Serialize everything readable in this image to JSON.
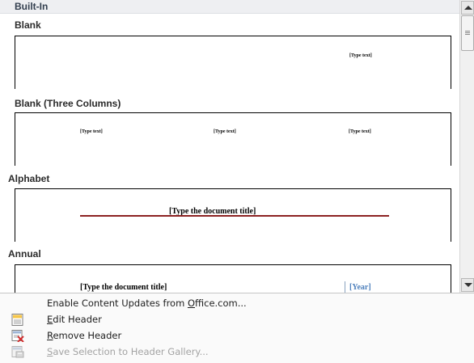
{
  "gallery": {
    "section_title": "Built-In",
    "items": [
      {
        "label": "Blank",
        "placeholders": [
          "[Type text]"
        ]
      },
      {
        "label": "Blank (Three Columns)",
        "placeholders": [
          "[Type text]",
          "[Type text]",
          "[Type text]"
        ]
      },
      {
        "label": "Alphabet",
        "title": "[Type the document title]"
      },
      {
        "label": "Annual",
        "title": "[Type the document title]",
        "year": "[Year]"
      }
    ]
  },
  "menu": {
    "items": [
      {
        "pre": "Enable Content Updates from ",
        "accel": "O",
        "post": "ffice.com...",
        "icon": "none",
        "disabled": false
      },
      {
        "pre": "",
        "accel": "E",
        "post": "dit Header",
        "icon": "edit-header-icon",
        "disabled": false
      },
      {
        "pre": "",
        "accel": "R",
        "post": "emove Header",
        "icon": "remove-header-icon",
        "disabled": false
      },
      {
        "pre": "",
        "accel": "S",
        "post": "ave Selection to Header Gallery...",
        "icon": "save-selection-icon",
        "disabled": true
      }
    ]
  },
  "colors": {
    "accent_rule": "#8c2222",
    "year_blue": "#4f81bd",
    "header_bg": "#eeeff2"
  }
}
